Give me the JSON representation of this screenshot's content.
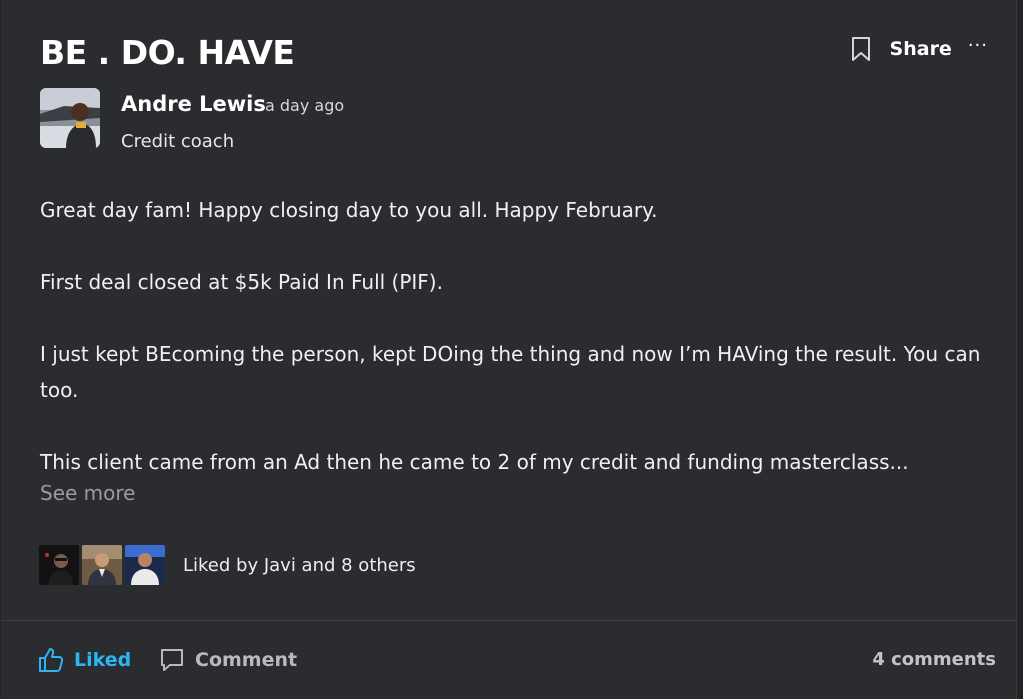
{
  "post": {
    "title": "BE . DO. HAVE",
    "share_label": "Share",
    "more_label": "···",
    "author": {
      "name": "Andre Lewis",
      "time": "a day ago",
      "role": "Credit coach"
    },
    "paragraphs": [
      "Great day fam! Happy closing day to you all. Happy February.",
      "First deal closed at $5k Paid In Full (PIF).",
      "I just kept BEcoming the person, kept DOing the thing and now I’m HAVing the result. You can too.",
      "This client came from an Ad then he came to 2 of my credit and funding masterclass..."
    ],
    "see_more": "See more",
    "liked_by": "Liked by Javi and 8 others",
    "actions": {
      "like_label": "Liked",
      "comment_label": "Comment"
    },
    "comment_count": "4 comments",
    "colors": {
      "background": "#2b2c30",
      "accent_liked": "#2bb6f2"
    },
    "icons": [
      "bookmark-icon",
      "more-icon",
      "thumbs-up-icon",
      "comment-icon"
    ]
  }
}
